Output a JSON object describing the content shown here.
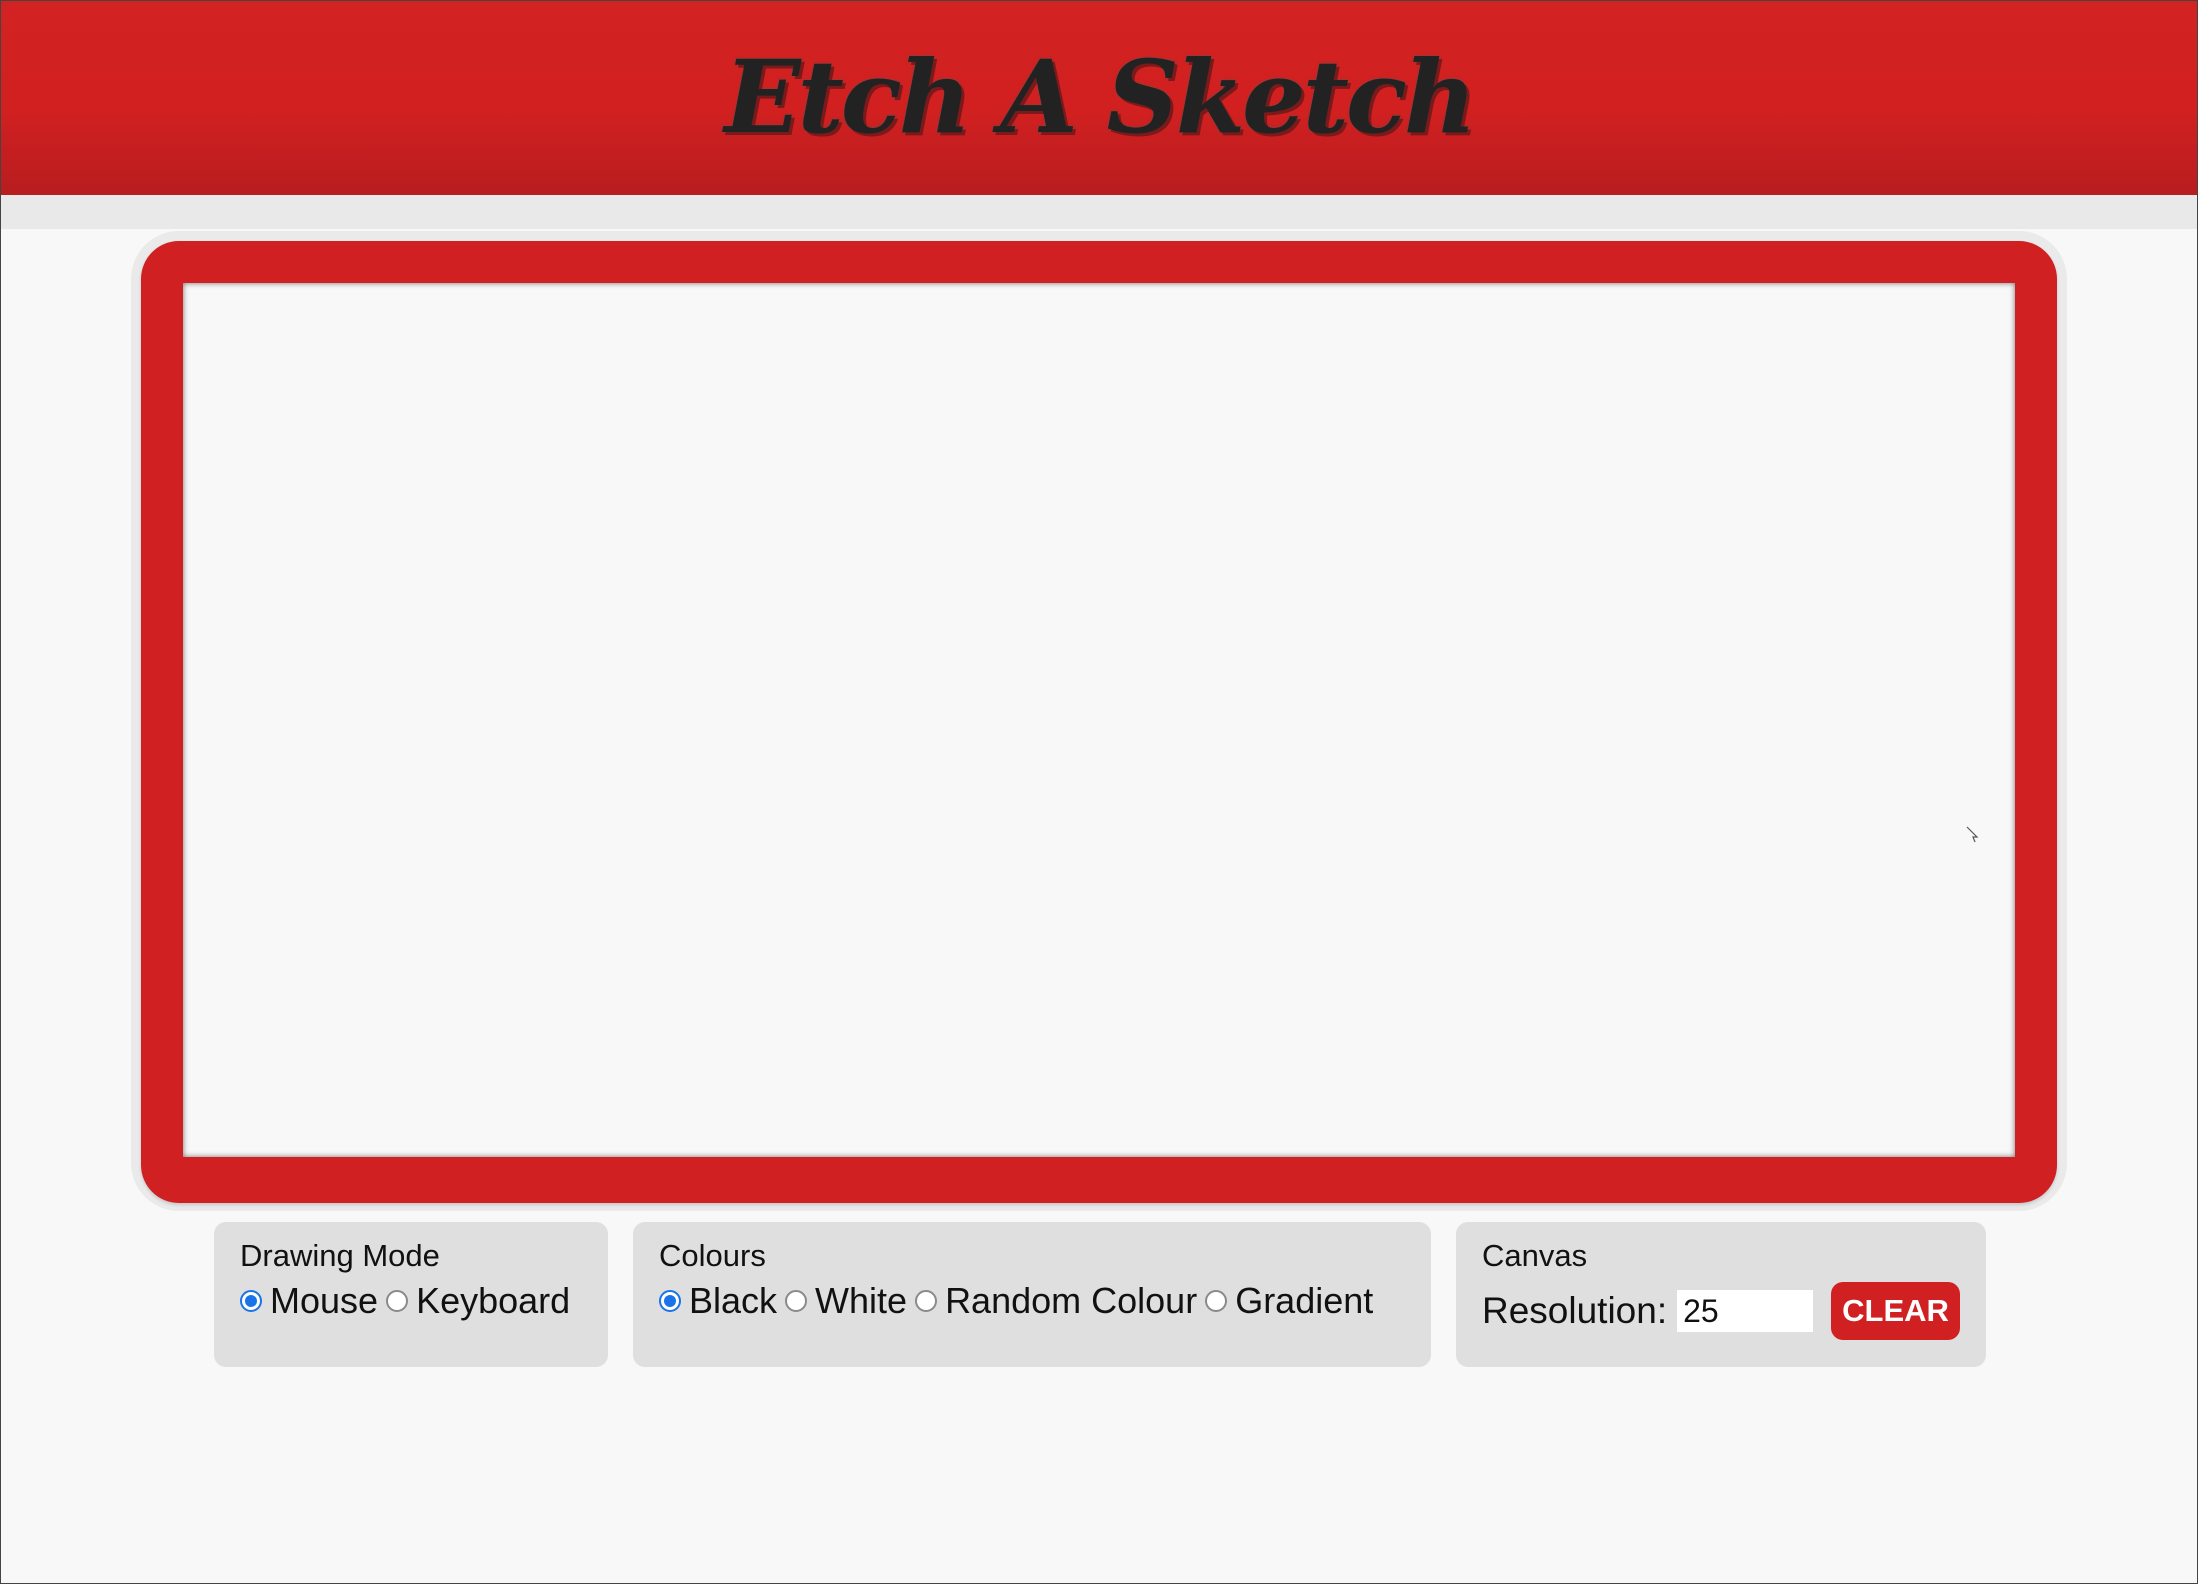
{
  "app": {
    "title": "Etch A Sketch"
  },
  "drawing_mode": {
    "title": "Drawing Mode",
    "options": [
      {
        "label": "Mouse",
        "checked": true
      },
      {
        "label": "Keyboard",
        "checked": false
      }
    ]
  },
  "colours": {
    "title": "Colours",
    "options": [
      {
        "label": "Black",
        "checked": true
      },
      {
        "label": "White",
        "checked": false
      },
      {
        "label": "Random Colour",
        "checked": false
      },
      {
        "label": "Gradient",
        "checked": false
      }
    ]
  },
  "canvas": {
    "title": "Canvas",
    "resolution_label": "Resolution:",
    "resolution_value": "25",
    "clear_label": "CLEAR"
  },
  "colors": {
    "brand_red": "#d12021",
    "panel_bg": "#dfdfdf",
    "screen_bg": "#f8f8f8",
    "radio_accent": "#1a73e8"
  },
  "icons": {
    "cursor": "pointer-cursor-icon"
  }
}
